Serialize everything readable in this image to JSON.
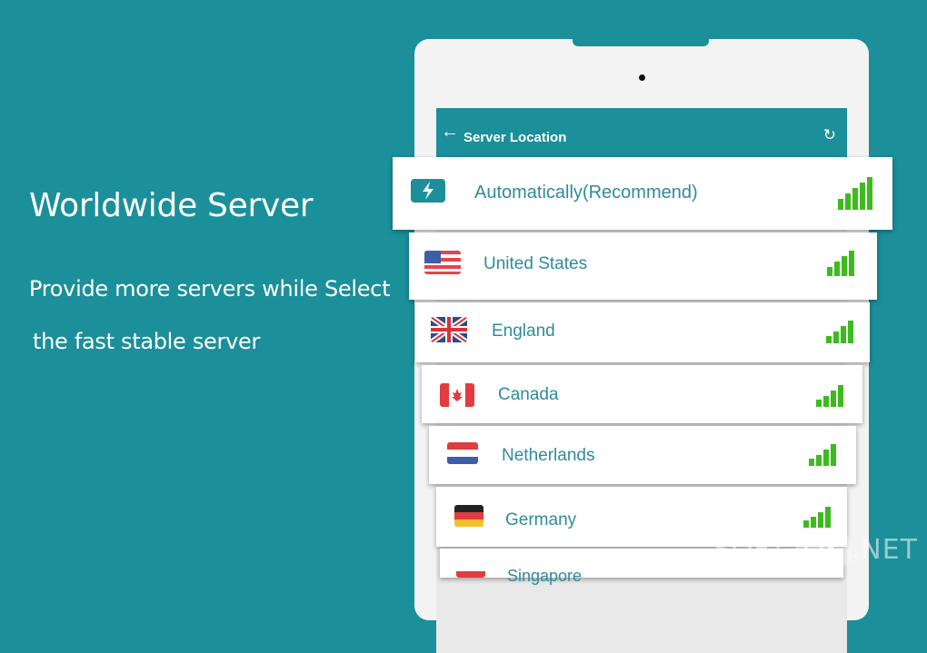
{
  "promo": {
    "headline": "Worldwide Server",
    "subline1": "Provide more servers while Select",
    "subline2": "the fast stable server"
  },
  "appbar": {
    "title": "Server Location",
    "back_icon": "arrow-left-icon",
    "refresh_icon": "refresh-icon"
  },
  "servers": [
    {
      "label": "Automatically(Recommend)",
      "icon": "lightning-icon"
    },
    {
      "label": "United States",
      "icon": "flag-us-icon"
    },
    {
      "label": "England",
      "icon": "flag-uk-icon"
    },
    {
      "label": "Canada",
      "icon": "flag-canada-icon"
    },
    {
      "label": "Netherlands",
      "icon": "flag-netherlands-icon"
    },
    {
      "label": "Germany",
      "icon": "flag-germany-icon"
    },
    {
      "label": "Singapore",
      "icon": "flag-singapore-icon"
    }
  ],
  "signal_color": "#3dbb1e",
  "accent_color": "#1b8f9a",
  "watermark": {
    "pre": "SOFT-",
    "ok": "OK",
    "post": ".NET"
  }
}
